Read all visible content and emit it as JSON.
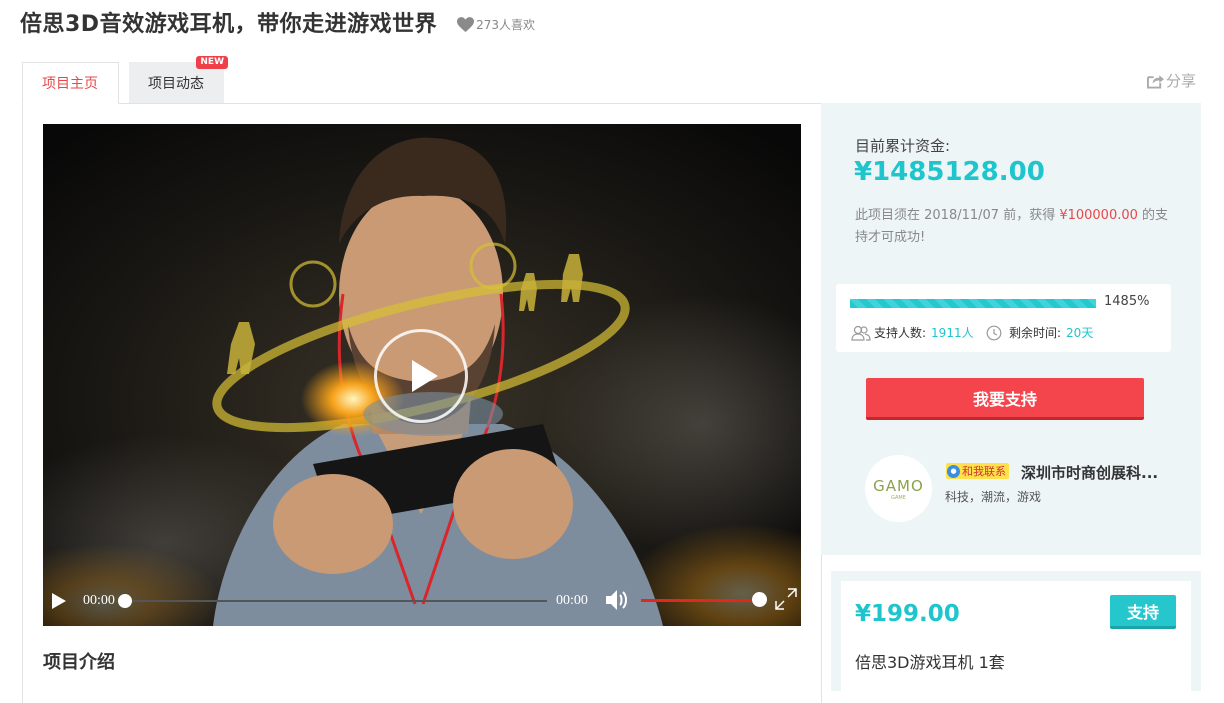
{
  "page": {
    "title": "倍思3D音效游戏耳机，带你走进游戏世界",
    "likes": "273人喜欢",
    "share_label": "分享"
  },
  "tabs": [
    {
      "label": "项目主页",
      "active": true
    },
    {
      "label": "项目动态",
      "badge": "NEW"
    }
  ],
  "video": {
    "current_time": "00:00",
    "duration": "00:00",
    "progress": 0,
    "volume": 1.0
  },
  "main": {
    "section_title": "项目介绍"
  },
  "funding": {
    "label": "目前累计资金:",
    "amount": "¥1485128.00",
    "deadline_prefix": "此项目须在 2018/11/07 前，获得 ",
    "goal": "¥100000.00",
    "deadline_suffix": " 的支持才可成功!",
    "progress_percent": "1485%",
    "progress_fill": 1.0,
    "backers_label": "支持人数:",
    "backers_value": "1911人",
    "time_label": "剩余时间:",
    "time_value": "20天",
    "support_button": "我要支持"
  },
  "company": {
    "logo_text": "GAMO",
    "logo_subtext": "GAME",
    "contact_label": "和我联系",
    "name": "深圳市时商创展科...",
    "tags": "科技，潮流，游戏"
  },
  "reward": {
    "price": "¥199.00",
    "button": "支持",
    "description": "倍思3D游戏耳机 1套"
  },
  "colors": {
    "accent_teal": "#1fc5cc",
    "accent_red": "#f4444c",
    "tab_active_text": "#e84848",
    "sidebar_bg": "#eef5f7"
  },
  "icons": {
    "likes": "heart-icon",
    "share": "share-icon",
    "backers": "users-icon",
    "time": "clock-icon"
  }
}
